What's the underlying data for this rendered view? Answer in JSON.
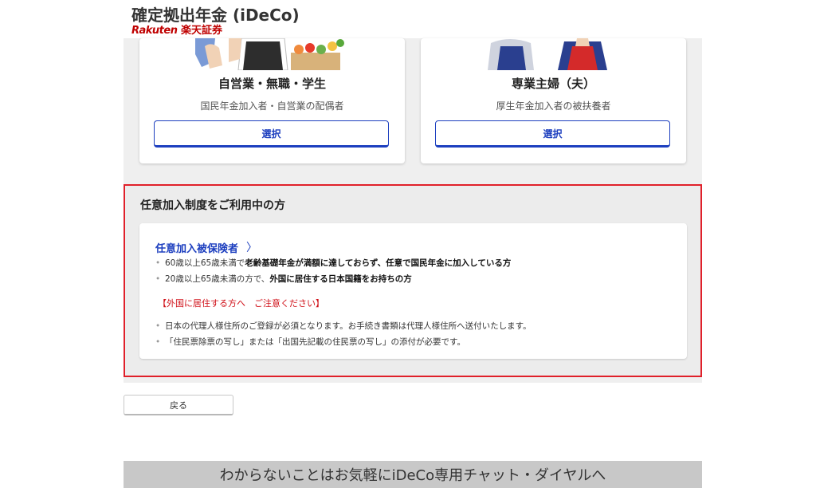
{
  "header": {
    "title": "確定拠出年金 (iDeCo)",
    "sub_brand_latin": "Rakuten",
    "sub_brand_jp": "楽天証券"
  },
  "cards": [
    {
      "title": "自営業・無職・学生",
      "description": "国民年金加入者・自営業の配偶者",
      "button": "選択"
    },
    {
      "title": "専業主婦（夫）",
      "description": "厚生年金加入者の被扶養者",
      "button": "選択"
    }
  ],
  "voluntary": {
    "heading": "任意加入制度をご利用中の方",
    "link_label": "任意加入被保険者",
    "link_chevron": "〉",
    "bullets_eligibility": [
      {
        "pre": "60歳以上65歳未満で",
        "bold": "老齢基礎年金が満額に達しておらず、任意で国民年金に加入している方",
        "post": ""
      },
      {
        "pre": "20歳以上65歳未満の方で、",
        "bold": "外国に居住する日本国籍をお持ちの方",
        "post": ""
      }
    ],
    "notice": "【外国に居住する方へ　ご注意ください】",
    "bullets_notice": [
      "日本の代理人様住所のご登録が必須となります。お手続き書類は代理人様住所へ送付いたします。",
      "「住民票除票の写し」または「出国先記載の住民票の写し」の添付が必要です。"
    ]
  },
  "back_button": "戻る",
  "footer_banner": "わからないことはお気軽にiDeCo専用チャット・ダイヤルへ",
  "colors": {
    "accent_blue": "#1d3fbf",
    "highlight_red": "#e0202a",
    "brand_red": "#bf0000"
  }
}
